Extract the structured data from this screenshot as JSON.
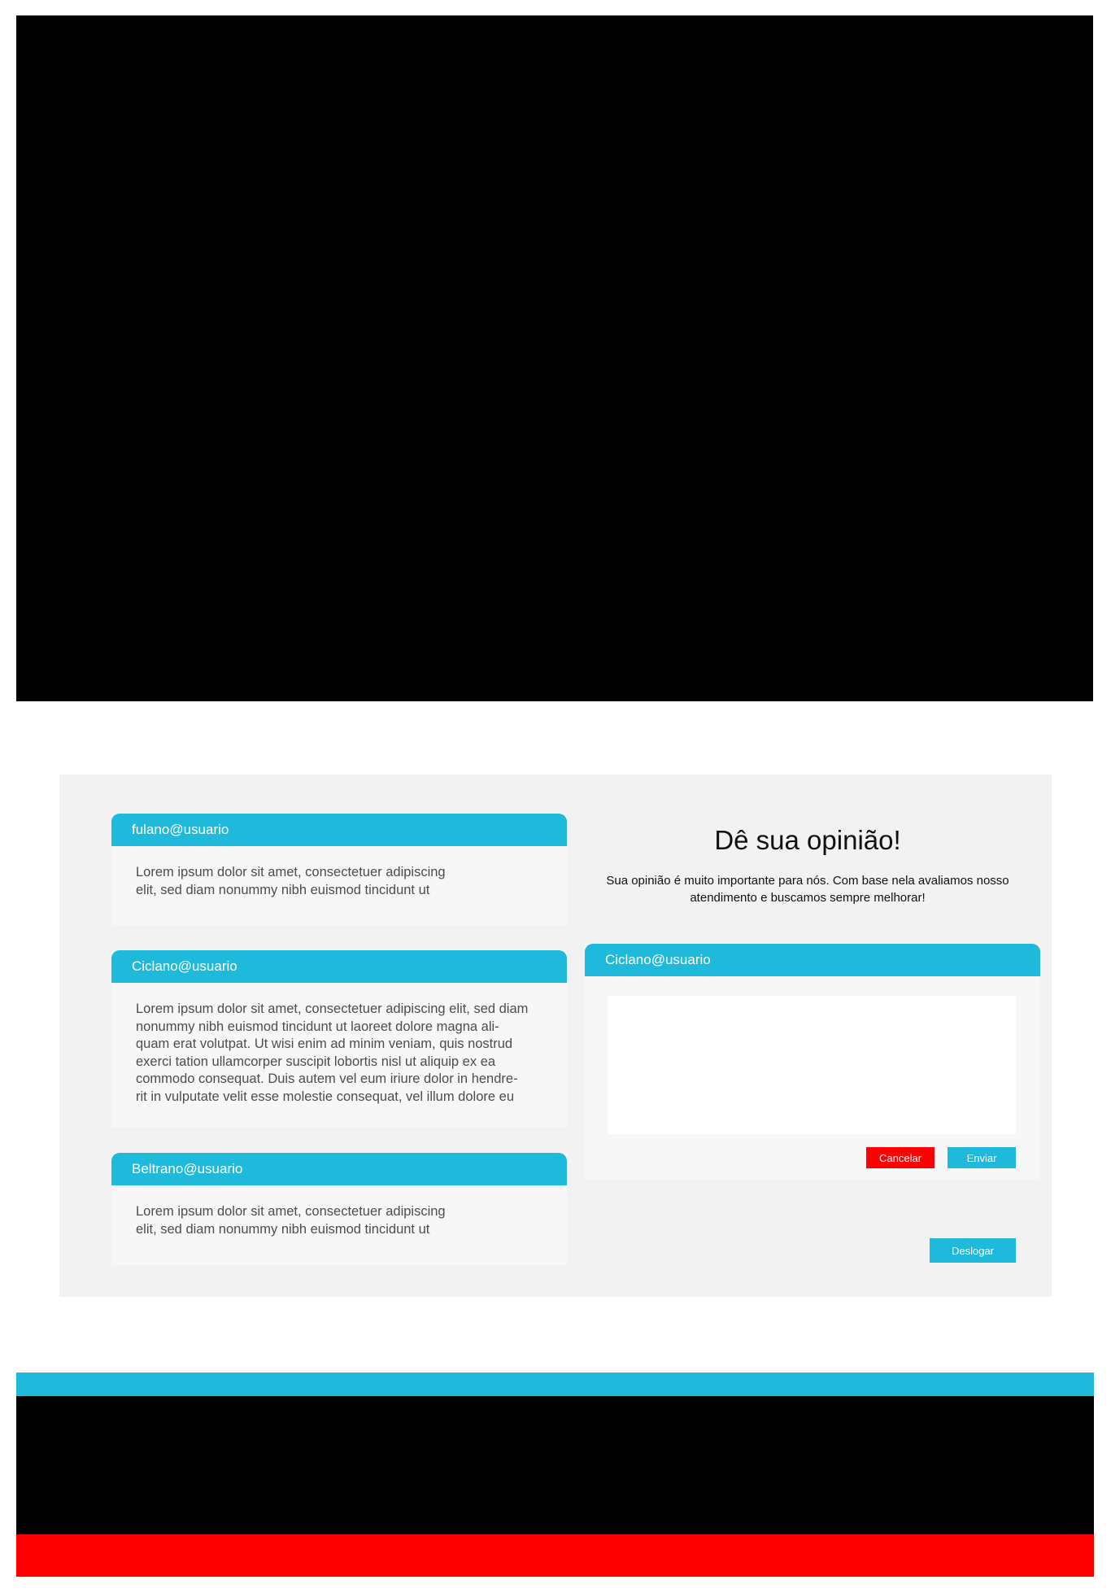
{
  "comments": [
    {
      "user": "fulano@usuario",
      "text": "Lorem ipsum dolor sit amet, consectetuer adipiscing\nelit, sed diam nonummy nibh euismod tincidunt ut"
    },
    {
      "user": "Ciclano@usuario",
      "text": "Lorem ipsum dolor sit amet, consectetuer adipiscing elit, sed diam\nnonummy nibh euismod tincidunt ut laoreet dolore magna ali-\nquam erat volutpat. Ut wisi enim ad minim veniam, quis nostrud\nexerci tation ullamcorper suscipit lobortis nisl ut aliquip ex ea\ncommodo consequat. Duis autem vel eum iriure dolor in hendre-\nrit in vulputate velit esse molestie consequat, vel illum dolore eu"
    },
    {
      "user": "Beltrano@usuario",
      "text": "Lorem ipsum dolor sit amet, consectetuer adipiscing\nelit, sed diam nonummy nibh euismod tincidunt ut"
    }
  ],
  "feedback": {
    "title": "Dê sua opinião!",
    "subtitle": "Sua opinião é muito importante para nós. Com base nela avaliamos nosso\natendimento e buscamos sempre melhorar!",
    "user": "Ciclano@usuario",
    "message_value": "",
    "cancel_label": "Cancelar",
    "send_label": "Enviar"
  },
  "logout_label": "Deslogar",
  "colors": {
    "accent": "#1fb9dc",
    "danger": "#ff0000",
    "panel_bg": "#f2f2f2",
    "card_bg": "#f7f7f7"
  }
}
